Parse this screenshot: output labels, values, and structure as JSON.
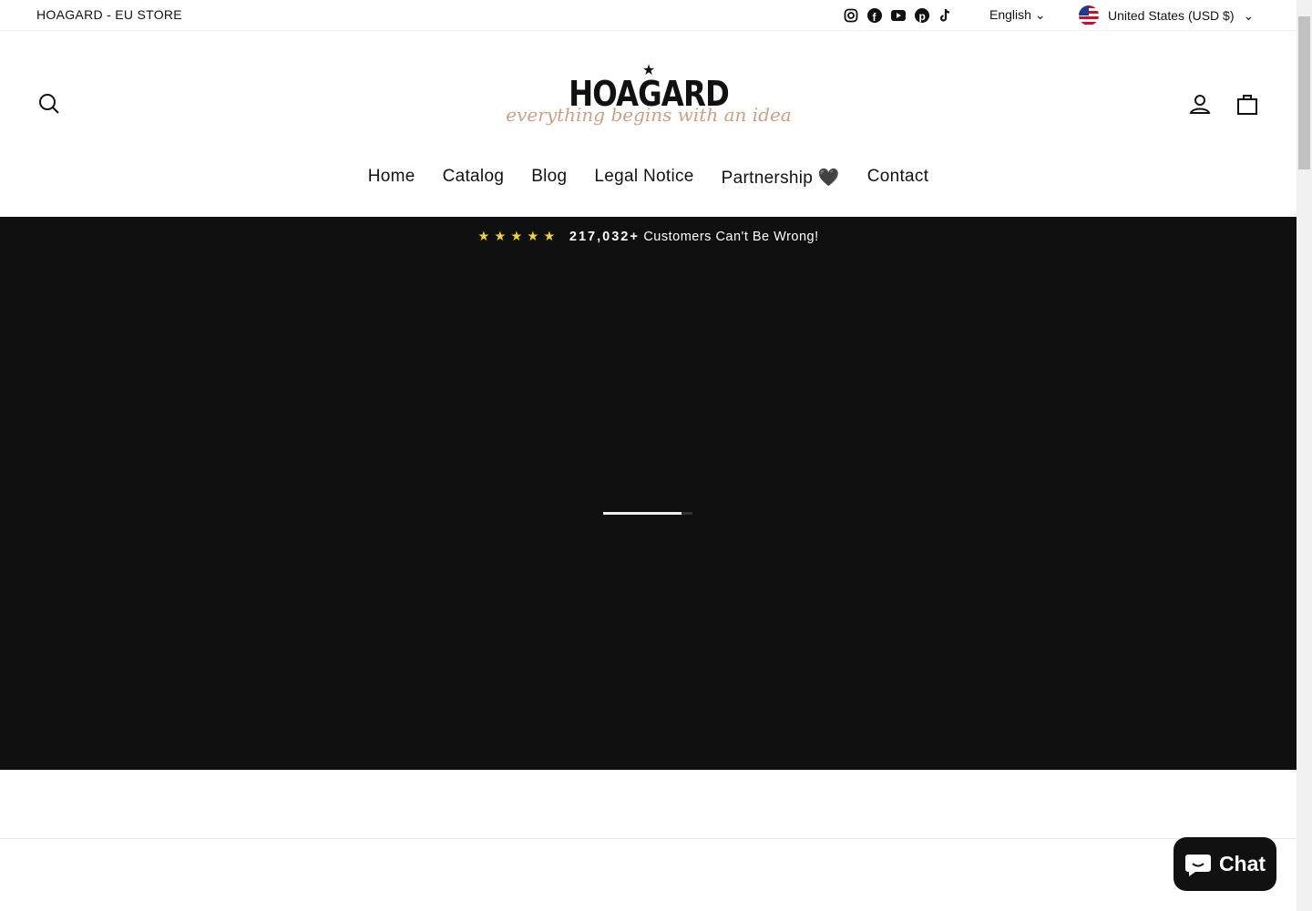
{
  "topbar": {
    "store_name": "HOAGARD - EU STORE",
    "social": [
      "instagram-icon",
      "facebook-icon",
      "youtube-icon",
      "pinterest-icon",
      "tiktok-icon"
    ],
    "language": "English",
    "currency": "United States (USD $)"
  },
  "logo": {
    "brand": "HOAGARD",
    "tagline": "everything begins with an idea"
  },
  "nav": [
    {
      "label": "Home"
    },
    {
      "label": "Catalog"
    },
    {
      "label": "Blog"
    },
    {
      "label": "Legal Notice"
    },
    {
      "label": "Partnership"
    },
    {
      "label": "Contact"
    }
  ],
  "hero": {
    "stars": "★★★★★",
    "count": "217,032+",
    "text": "Customers Can't Be Wrong!",
    "loading_progress": 0.88
  },
  "chat": {
    "label": "Chat"
  },
  "colors": {
    "hero_bg": "#0f0f10",
    "star": "#f5d130",
    "tagline": "#c9a08a"
  }
}
